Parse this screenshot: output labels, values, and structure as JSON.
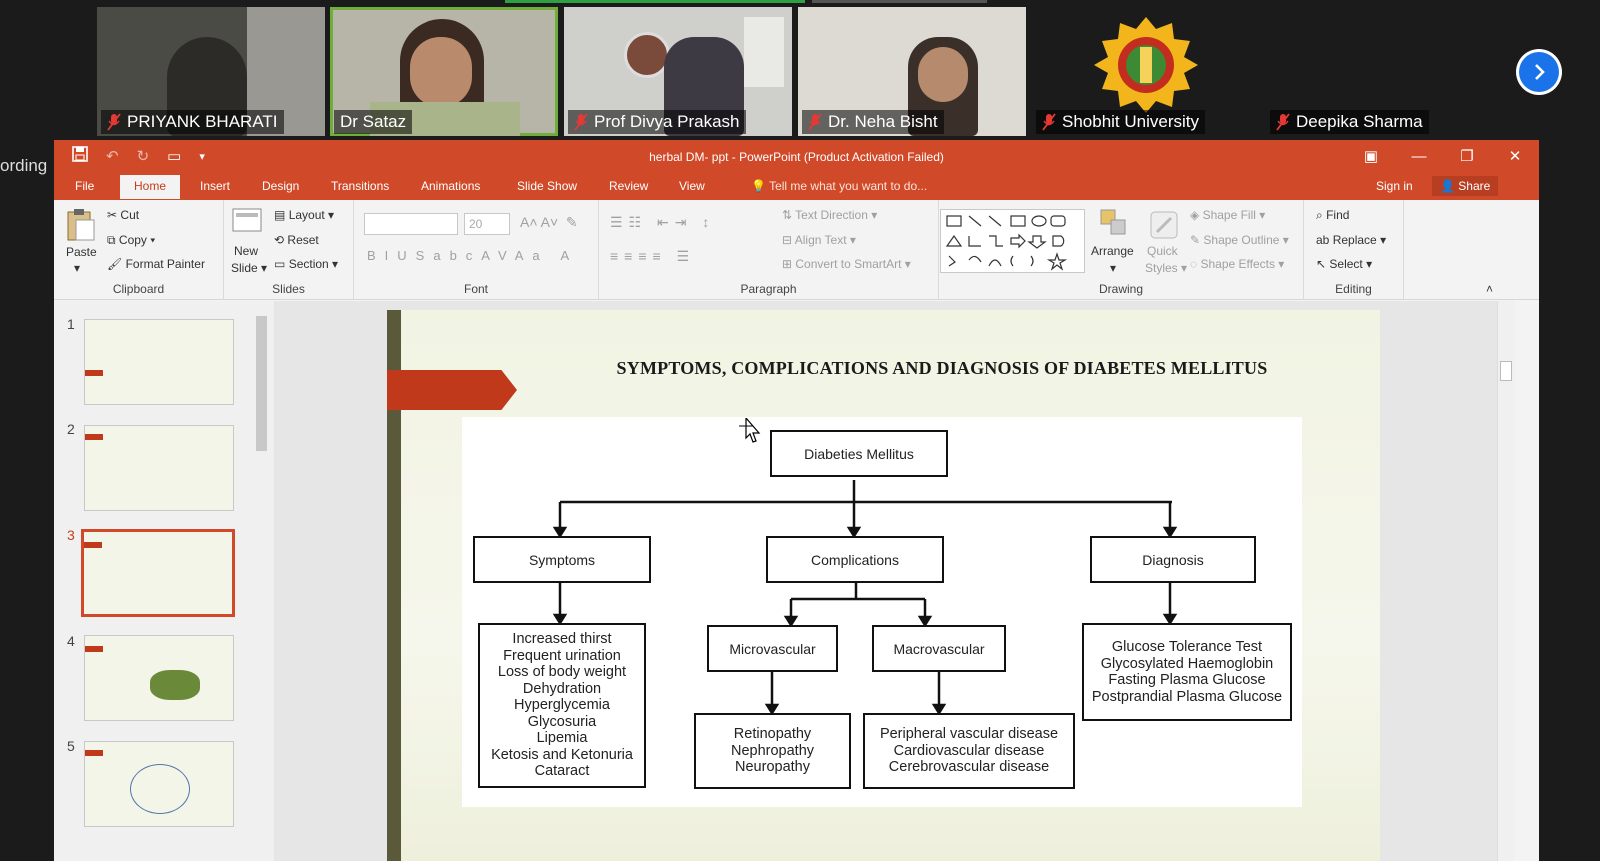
{
  "meeting": {
    "participants": [
      {
        "name": "PRIYANK BHARATI",
        "muted": true
      },
      {
        "name": "Dr Sataz",
        "muted": false,
        "active": true
      },
      {
        "name": "Prof Divya Prakash",
        "muted": true
      },
      {
        "name": "Dr. Neha Bisht",
        "muted": true
      },
      {
        "name": "Shobhit University",
        "muted": true
      },
      {
        "name": "Deepika Sharma",
        "muted": true
      }
    ],
    "recording_label": "ording",
    "logo_text": "SHOBHIT UNIVERSITY"
  },
  "window": {
    "title": "herbal DM- ppt - PowerPoint (Product Activation Failed)",
    "accent": "#d04a2a"
  },
  "tabs": [
    "File",
    "Home",
    "Insert",
    "Design",
    "Transitions",
    "Animations",
    "Slide Show",
    "Review",
    "View"
  ],
  "tell_me": "Tell me what you want to do...",
  "sign_in": "Sign in",
  "share": "Share",
  "ribbon": {
    "clipboard": {
      "paste": "Paste",
      "cut": "Cut",
      "copy": "Copy",
      "format_painter": "Format Painter",
      "label": "Clipboard"
    },
    "slides": {
      "new_slide": "New",
      "new_slide2": "Slide",
      "layout": "Layout",
      "reset": "Reset",
      "section": "Section",
      "label": "Slides"
    },
    "font": {
      "size": "20",
      "label": "Font"
    },
    "paragraph": {
      "text_direction": "Text Direction",
      "align_text": "Align Text",
      "convert": "Convert to SmartArt",
      "label": "Paragraph"
    },
    "drawing": {
      "arrange": "Arrange",
      "quick_styles": "Quick",
      "quick_styles2": "Styles",
      "shape_fill": "Shape Fill",
      "shape_outline": "Shape Outline",
      "shape_effects": "Shape Effects",
      "label": "Drawing"
    },
    "editing": {
      "find": "Find",
      "replace": "Replace",
      "select": "Select",
      "label": "Editing"
    }
  },
  "thumbnails": [
    {
      "num": "1",
      "selected": false
    },
    {
      "num": "2",
      "selected": false
    },
    {
      "num": "3",
      "selected": true
    },
    {
      "num": "4",
      "selected": false
    },
    {
      "num": "5",
      "selected": false
    }
  ],
  "slide": {
    "title": "SYMPTOMS, COMPLICATIONS AND DIAGNOSIS OF DIABETES MELLITUS",
    "root": "Diabeties Mellitus",
    "symptoms": "Symptoms",
    "complications": "Complications",
    "diagnosis": "Diagnosis",
    "microvascular": "Microvascular",
    "macrovascular": "Macrovascular",
    "symptom_list": [
      "Increased thirst",
      "Frequent urination",
      "Loss of body weight",
      "Dehydration",
      "Hyperglycemia",
      "Glycosuria",
      "Lipemia",
      "Ketosis and Ketonuria",
      "Cataract"
    ],
    "diagnosis_list": [
      "Glucose Tolerance Test",
      "Glycosylated Haemoglobin",
      "Fasting Plasma Glucose",
      "Postprandial Plasma Glucose"
    ],
    "micro_list": [
      "Retinopathy",
      "Nephropathy",
      "Neuropathy"
    ],
    "macro_list": [
      "Peripheral vascular disease",
      "Cardiovascular disease",
      "Cerebrovascular disease"
    ]
  }
}
